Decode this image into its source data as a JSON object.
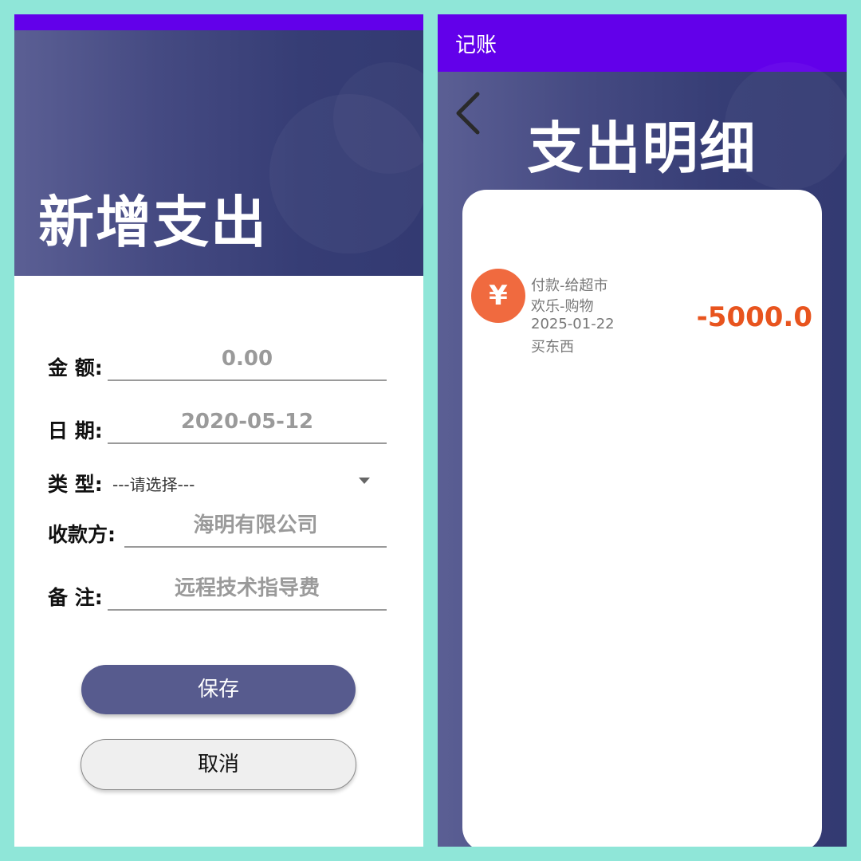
{
  "left": {
    "title": "新增支出",
    "form": {
      "amount_label": "金 额:",
      "amount_value": "0.00",
      "date_label": "日 期:",
      "date_value": "2020-05-12",
      "type_label": "类 型:",
      "type_value": "---请选择---",
      "payee_label": "收款方:",
      "payee_value": "海明有限公司",
      "note_label": "备 注:",
      "note_value": "远程技术指导费"
    },
    "save_label": "保存",
    "cancel_label": "取消"
  },
  "right": {
    "app_title": "记账",
    "page_title": "支出明细",
    "entry": {
      "icon_glyph": "¥",
      "line1": "付款-给超市",
      "line2": "欢乐-购物",
      "line3": "2025-01-22",
      "line4": "买东西",
      "amount": "-5000.0"
    }
  },
  "colors": {
    "status_bar": "#6200ea",
    "header_gradient_start": "#5b5f94",
    "header_gradient_end": "#333a72",
    "accent_orange": "#e8541e",
    "icon_orange": "#f06a3f",
    "save_button": "#575b8e",
    "background": "#8fe6d8"
  }
}
